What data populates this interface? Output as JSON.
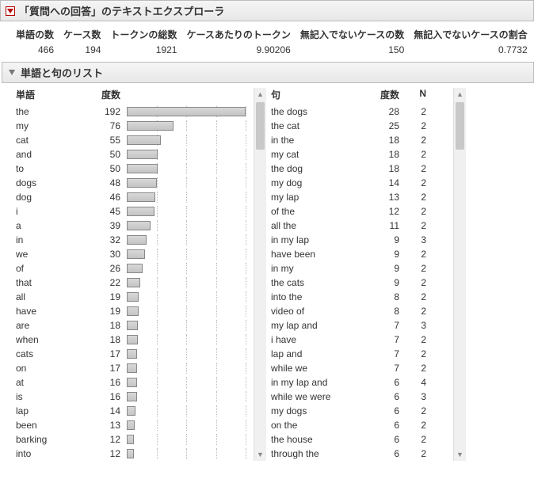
{
  "header": {
    "main_title": "「質問への回答」のテキストエクスプローラ",
    "sub_title": "単語と句のリスト"
  },
  "summary": {
    "cols": [
      {
        "label": "単語の数",
        "value": "466"
      },
      {
        "label": "ケース数",
        "value": "194"
      },
      {
        "label": "トークンの総数",
        "value": "1921"
      },
      {
        "label": "ケースあたりのトークン",
        "value": "9.90206"
      },
      {
        "label": "無記入でないケースの数",
        "value": "150"
      },
      {
        "label": "無記入でないケースの割合",
        "value": "0.7732"
      }
    ]
  },
  "word_table": {
    "headers": {
      "word": "単語",
      "freq": "度数"
    },
    "max": 192,
    "rows": [
      {
        "word": "the",
        "freq": 192
      },
      {
        "word": "my",
        "freq": 76
      },
      {
        "word": "cat",
        "freq": 55
      },
      {
        "word": "and",
        "freq": 50
      },
      {
        "word": "to",
        "freq": 50
      },
      {
        "word": "dogs",
        "freq": 48
      },
      {
        "word": "dog",
        "freq": 46
      },
      {
        "word": "i",
        "freq": 45
      },
      {
        "word": "a",
        "freq": 39
      },
      {
        "word": "in",
        "freq": 32
      },
      {
        "word": "we",
        "freq": 30
      },
      {
        "word": "of",
        "freq": 26
      },
      {
        "word": "that",
        "freq": 22
      },
      {
        "word": "all",
        "freq": 19
      },
      {
        "word": "have",
        "freq": 19
      },
      {
        "word": "are",
        "freq": 18
      },
      {
        "word": "when",
        "freq": 18
      },
      {
        "word": "cats",
        "freq": 17
      },
      {
        "word": "on",
        "freq": 17
      },
      {
        "word": "at",
        "freq": 16
      },
      {
        "word": "is",
        "freq": 16
      },
      {
        "word": "lap",
        "freq": 14
      },
      {
        "word": "been",
        "freq": 13
      },
      {
        "word": "barking",
        "freq": 12
      },
      {
        "word": "into",
        "freq": 12
      }
    ]
  },
  "phrase_table": {
    "headers": {
      "phrase": "句",
      "freq": "度数",
      "n": "N"
    },
    "rows": [
      {
        "phrase": "the dogs",
        "freq": 28,
        "n": 2
      },
      {
        "phrase": "the cat",
        "freq": 25,
        "n": 2
      },
      {
        "phrase": "in the",
        "freq": 18,
        "n": 2
      },
      {
        "phrase": "my cat",
        "freq": 18,
        "n": 2
      },
      {
        "phrase": "the dog",
        "freq": 18,
        "n": 2
      },
      {
        "phrase": "my dog",
        "freq": 14,
        "n": 2
      },
      {
        "phrase": "my lap",
        "freq": 13,
        "n": 2
      },
      {
        "phrase": "of the",
        "freq": 12,
        "n": 2
      },
      {
        "phrase": "all the",
        "freq": 11,
        "n": 2
      },
      {
        "phrase": "in my lap",
        "freq": 9,
        "n": 3
      },
      {
        "phrase": "have been",
        "freq": 9,
        "n": 2
      },
      {
        "phrase": "in my",
        "freq": 9,
        "n": 2
      },
      {
        "phrase": "the cats",
        "freq": 9,
        "n": 2
      },
      {
        "phrase": "into the",
        "freq": 8,
        "n": 2
      },
      {
        "phrase": "video of",
        "freq": 8,
        "n": 2
      },
      {
        "phrase": "my lap and",
        "freq": 7,
        "n": 3
      },
      {
        "phrase": "i have",
        "freq": 7,
        "n": 2
      },
      {
        "phrase": "lap and",
        "freq": 7,
        "n": 2
      },
      {
        "phrase": "while we",
        "freq": 7,
        "n": 2
      },
      {
        "phrase": "in my lap and",
        "freq": 6,
        "n": 4
      },
      {
        "phrase": "while we were",
        "freq": 6,
        "n": 3
      },
      {
        "phrase": "my dogs",
        "freq": 6,
        "n": 2
      },
      {
        "phrase": "on the",
        "freq": 6,
        "n": 2
      },
      {
        "phrase": "the house",
        "freq": 6,
        "n": 2
      },
      {
        "phrase": "through the",
        "freq": 6,
        "n": 2
      }
    ]
  }
}
